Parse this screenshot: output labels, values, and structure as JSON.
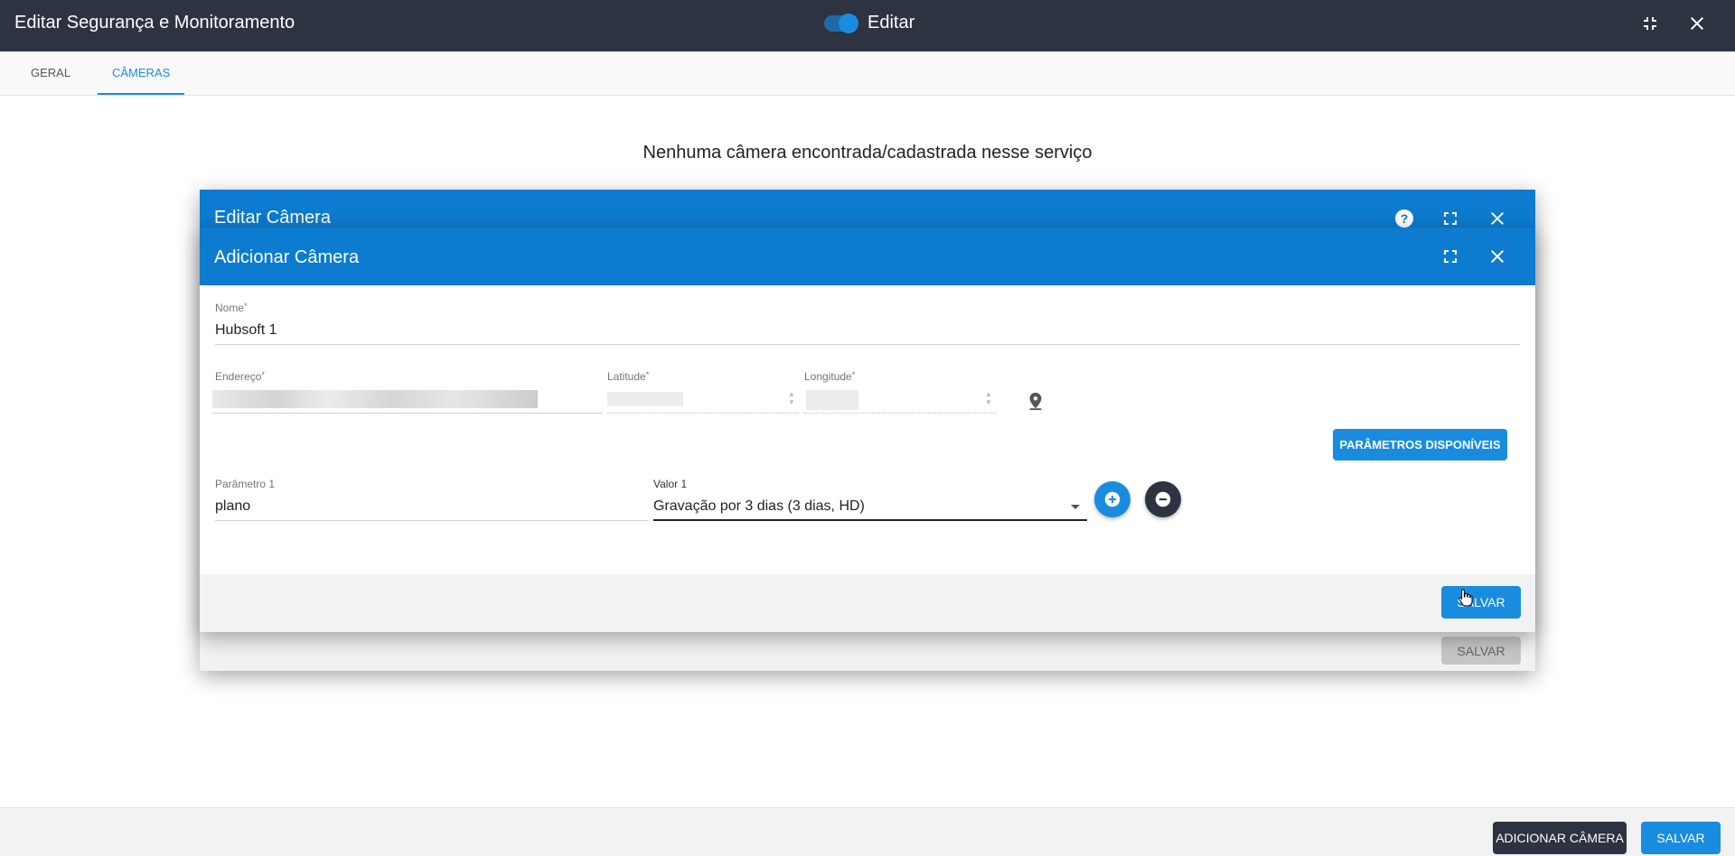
{
  "header": {
    "title": "Editar Segurança e Monitoramento",
    "toggle_label": "Editar",
    "toggle_on": true,
    "icons": [
      "collapse-icon",
      "close-icon"
    ]
  },
  "tabs": [
    {
      "label": "GERAL",
      "active": false
    },
    {
      "label": "CÂMERAS",
      "active": true
    }
  ],
  "main": {
    "empty_message": "Nenhuma câmera encontrada/cadastrada nesse serviço"
  },
  "back_dialog": {
    "title": "Editar Câmera",
    "icons": [
      "help-icon",
      "fullscreen-icon",
      "close-icon"
    ],
    "save_label": "SALVAR",
    "save_disabled": true
  },
  "dialog": {
    "title": "Adicionar Câmera",
    "icons": [
      "fullscreen-icon",
      "close-icon"
    ],
    "fields": {
      "nome": {
        "label": "Nome",
        "required": "*",
        "value": "Hubsoft 1"
      },
      "endereco": {
        "label": "Endereço",
        "required": "*"
      },
      "latitude": {
        "label": "Latitude",
        "required": "*"
      },
      "longitude": {
        "label": "Longitude",
        "required": "*"
      }
    },
    "params_button": "PARÂMETROS DISPONÍVEIS",
    "param": {
      "label": "Parâmetro 1",
      "value": "plano",
      "value_label": "Valor 1",
      "selected": "Gravação por 3 dias (3 dias, HD)"
    },
    "save_label": "SALVAR"
  },
  "bottom": {
    "add_camera_label": "ADICIONAR CÂMERA",
    "save_label": "SALVAR"
  },
  "colors": {
    "header_bg": "#2d3340",
    "accent": "#1a8ce0",
    "dialog_header": "#0d7bcf"
  }
}
